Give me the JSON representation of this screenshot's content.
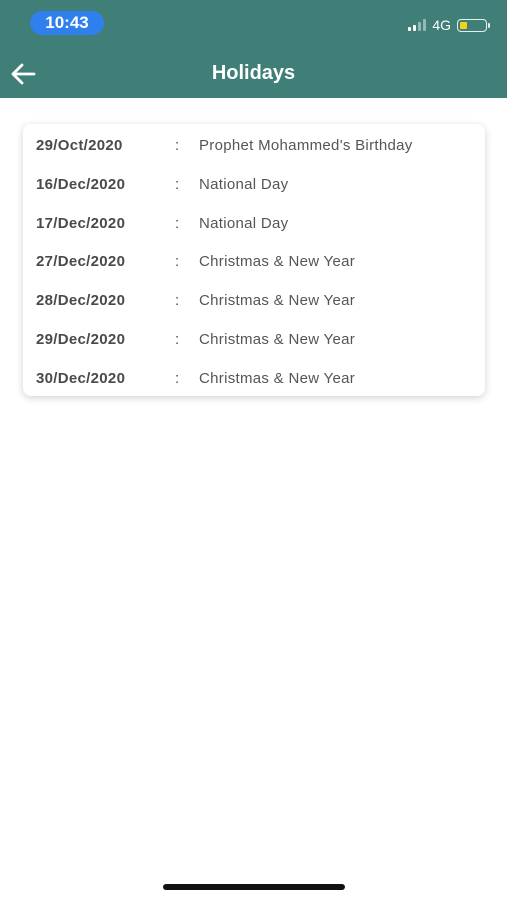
{
  "status_bar": {
    "time": "10:43",
    "network": "4G"
  },
  "header": {
    "title": "Holidays",
    "color": "#3f7f78"
  },
  "holidays": [
    {
      "date": "29/Oct/2020",
      "separator": ":",
      "name": "Prophet Mohammed's Birthday"
    },
    {
      "date": "16/Dec/2020",
      "separator": ":",
      "name": "National Day"
    },
    {
      "date": "17/Dec/2020",
      "separator": ":",
      "name": "National Day"
    },
    {
      "date": "27/Dec/2020",
      "separator": ":",
      "name": "Christmas & New Year"
    },
    {
      "date": "28/Dec/2020",
      "separator": ":",
      "name": "Christmas & New Year"
    },
    {
      "date": "29/Dec/2020",
      "separator": ":",
      "name": "Christmas & New Year"
    },
    {
      "date": "30/Dec/2020",
      "separator": ":",
      "name": "Christmas & New Year"
    }
  ],
  "icons": {
    "back": "back-arrow-icon",
    "signal": "signal-icon",
    "battery": "battery-icon"
  }
}
